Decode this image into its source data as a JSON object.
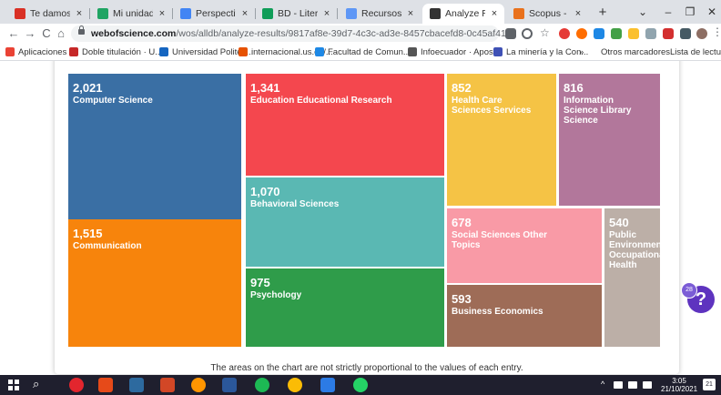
{
  "browser": {
    "tabs": [
      {
        "title": "Te damos la bien",
        "favicon_color": "#d93025"
      },
      {
        "title": "Mi unidad - Goo",
        "favicon_color": "#1fa463"
      },
      {
        "title": "Perspectivas de",
        "favicon_color": "#4285f4"
      },
      {
        "title": "BD - Literatura si",
        "favicon_color": "#0f9d58"
      },
      {
        "title": "Recursos Científ",
        "favicon_color": "#5e97f6"
      },
      {
        "title": "Analyze Results",
        "favicon_color": "#333333"
      },
      {
        "title": "Scopus - Docum",
        "favicon_color": "#e9711c"
      }
    ],
    "active_tab": 5,
    "new_tab_label": "+",
    "window_controls": {
      "dropdown": "⌄",
      "minimize": "–",
      "maximize": "❐",
      "close": "✕"
    },
    "nav": {
      "back": "←",
      "forward": "→",
      "reload": "C",
      "home": "⌂"
    },
    "url_host": "webofscience.com",
    "url_path": "/wos/alldb/analyze-results/9817af8e-39d7-4c3c-ad3e-8457cbacefd8-0c45af41"
  },
  "bookmarks": {
    "items": [
      {
        "label": "Aplicaciones",
        "color": "#ea4335"
      },
      {
        "label": "Doble titulación · U...",
        "color": "#c62828"
      },
      {
        "label": "Universidad Politéc...",
        "color": "#1565c0"
      },
      {
        "label": "internacional.us.es/...",
        "color": "#e65100"
      },
      {
        "label": "Facultad de Comun...",
        "color": "#1e88e5"
      },
      {
        "label": "Infoecuador · Apos...",
        "color": "#555555"
      },
      {
        "label": "La minería y la Con...",
        "color": "#3f51b5"
      }
    ],
    "overflow": "»",
    "other": "Otros marcadores",
    "reading_list": "Lista de lectura"
  },
  "chart_data": {
    "type": "treemap",
    "cells": [
      {
        "value": "2,021",
        "label": "Computer Science",
        "color": "#3a6fa4"
      },
      {
        "value": "1,515",
        "label": "Communication",
        "color": "#f7840c"
      },
      {
        "value": "1,341",
        "label": "Education Educational Research",
        "color": "#f4474e"
      },
      {
        "value": "1,070",
        "label": "Behavioral Sciences",
        "color": "#5ab8b3"
      },
      {
        "value": "975",
        "label": "Psychology",
        "color": "#2f9c4a"
      },
      {
        "value": "852",
        "label": "Health Care Sciences Services",
        "color": "#f5c345"
      },
      {
        "value": "816",
        "label": "Information Science Library Science",
        "color": "#b2779b"
      },
      {
        "value": "678",
        "label": "Social Sciences Other Topics",
        "color": "#f99aa6"
      },
      {
        "value": "593",
        "label": "Business Economics",
        "color": "#9e6c57"
      },
      {
        "value": "540",
        "label": "Public Environmental Occupational Health",
        "color": "#bcafa7"
      }
    ],
    "footnote": "The areas on the chart are not strictly proportional to the values of each entry."
  },
  "help": {
    "label": "?",
    "count": "28"
  },
  "taskbar": {
    "search_icon": "⌕",
    "tray_text": "^",
    "time": "3:05",
    "date": "21/10/2021",
    "notification_count": "21"
  }
}
